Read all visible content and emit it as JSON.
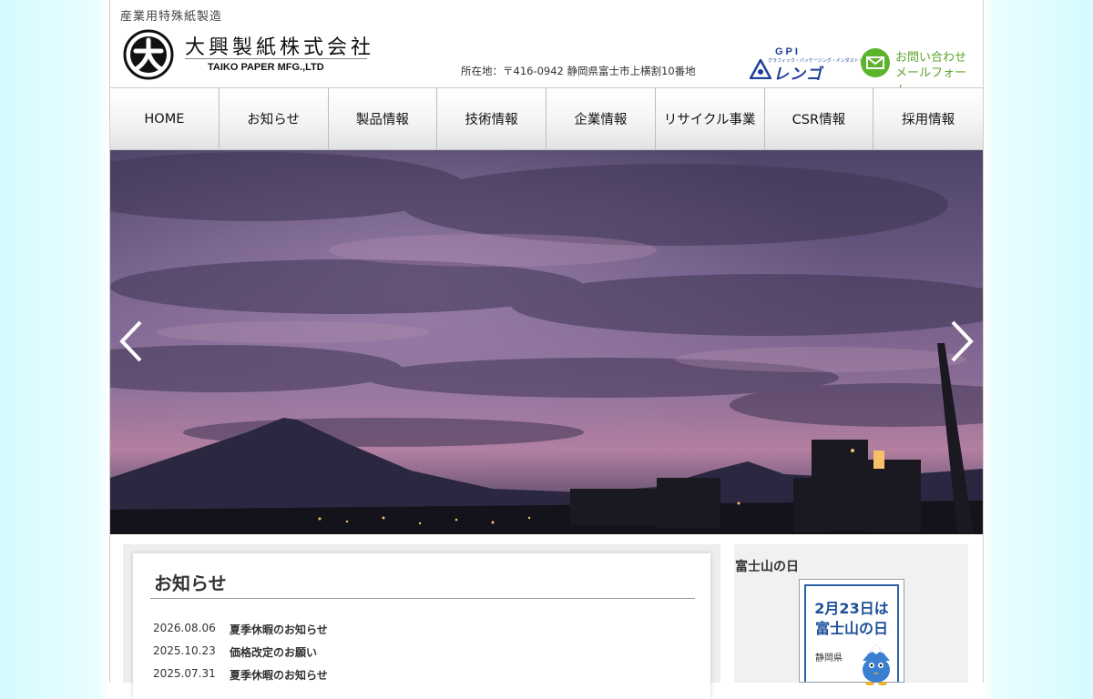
{
  "header": {
    "tagline": "産業用特殊紙製造",
    "company_jp": "大興製紙株式会社",
    "company_en": "TAIKO PAPER MFG.,LTD",
    "address": "所在地：〒416-0942 静岡県富士市上横割10番地",
    "group_logo": {
      "top": "GPI",
      "sub": "グラフィック・パッケージング・インダストリー",
      "name": "レンゴー"
    },
    "contact": {
      "line1": "お問い合わせ",
      "line2": "メールフォーム",
      "icon": "envelope-icon"
    }
  },
  "nav": {
    "items": [
      {
        "label": "HOME"
      },
      {
        "label": "お知らせ"
      },
      {
        "label": "製品情報"
      },
      {
        "label": "技術情報"
      },
      {
        "label": "企業情報"
      },
      {
        "label": "リサイクル事業"
      },
      {
        "label": "CSR情報"
      },
      {
        "label": "採用情報"
      }
    ]
  },
  "hero": {
    "prev_icon": "chevron-left-icon",
    "next_icon": "chevron-right-icon"
  },
  "news": {
    "title": "お知らせ",
    "items": [
      {
        "date": "2026.08.06",
        "text": "夏季休暇のお知らせ"
      },
      {
        "date": "2025.10.23",
        "text": "価格改定のお願い"
      },
      {
        "date": "2025.07.31",
        "text": "夏季休暇のお知らせ"
      }
    ]
  },
  "sidebar": {
    "title": "富士山の日",
    "banner": {
      "line1": "2月23日は",
      "line2": "富士山の日",
      "pref": "静岡県"
    }
  },
  "colors": {
    "accent_green": "#5cb42c",
    "group_blue": "#1f3f97",
    "banner_blue": "#1c4f9a"
  }
}
